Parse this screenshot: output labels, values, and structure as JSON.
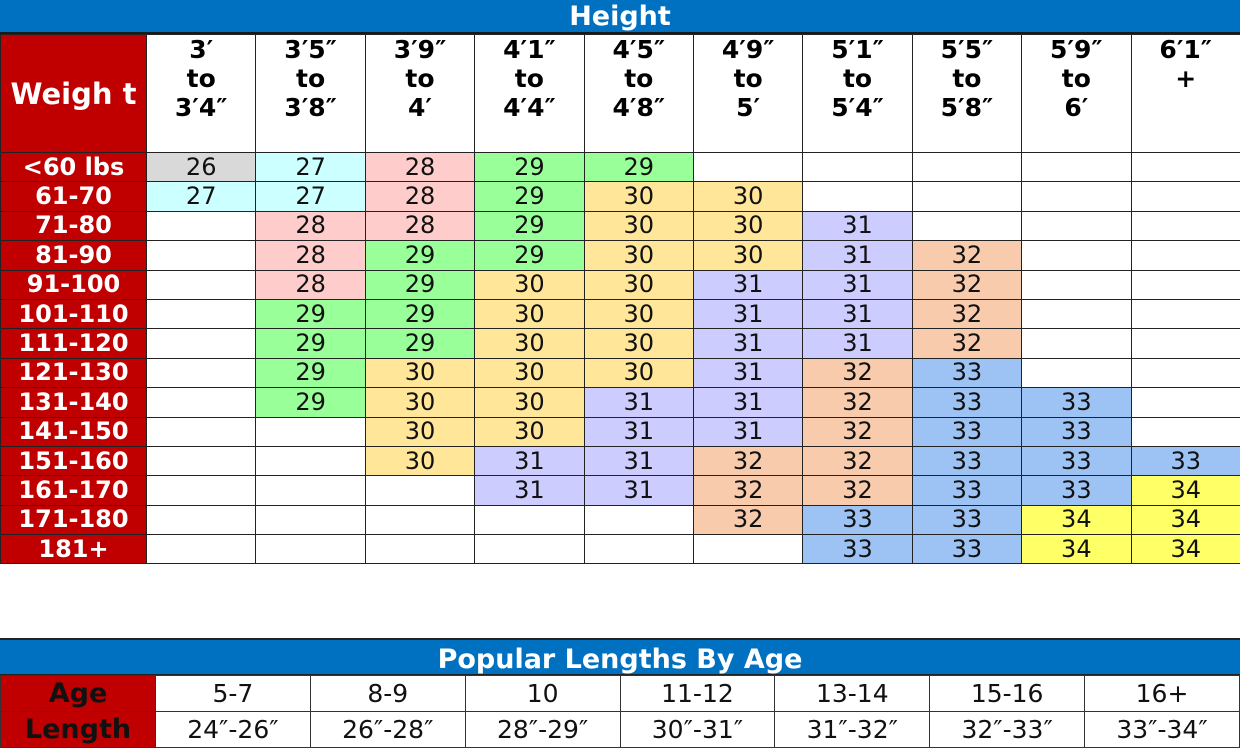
{
  "size_chart": {
    "title": "Height",
    "weight_header": "Weigh t",
    "height_columns": [
      [
        "3′",
        "to",
        "3′4″"
      ],
      [
        "3′5″",
        "to",
        "3′8″"
      ],
      [
        "3′9″",
        "to",
        "4′"
      ],
      [
        "4′1″",
        "to",
        "4′4″"
      ],
      [
        "4′5″",
        "to",
        "4′8″"
      ],
      [
        "4′9″",
        "to",
        "5′"
      ],
      [
        "5′1″",
        "to",
        "5′4″"
      ],
      [
        "5′5″",
        "to",
        "5′8″"
      ],
      [
        "5′9″",
        "to",
        "6′"
      ],
      [
        "6′1″",
        "+",
        ""
      ]
    ],
    "rows": [
      {
        "weight": "<60 lbs",
        "values": [
          "26",
          "27",
          "28",
          "29",
          "29",
          "",
          "",
          "",
          "",
          ""
        ]
      },
      {
        "weight": "61-70",
        "values": [
          "27",
          "27",
          "28",
          "29",
          "30",
          "30",
          "",
          "",
          "",
          ""
        ]
      },
      {
        "weight": "71-80",
        "values": [
          "",
          "28",
          "28",
          "29",
          "30",
          "30",
          "31",
          "",
          "",
          ""
        ]
      },
      {
        "weight": "81-90",
        "values": [
          "",
          "28",
          "29",
          "29",
          "30",
          "30",
          "31",
          "32",
          "",
          ""
        ]
      },
      {
        "weight": "91-100",
        "values": [
          "",
          "28",
          "29",
          "30",
          "30",
          "31",
          "31",
          "32",
          "",
          ""
        ]
      },
      {
        "weight": "101-110",
        "values": [
          "",
          "29",
          "29",
          "30",
          "30",
          "31",
          "31",
          "32",
          "",
          ""
        ]
      },
      {
        "weight": "111-120",
        "values": [
          "",
          "29",
          "29",
          "30",
          "30",
          "31",
          "31",
          "32",
          "",
          ""
        ]
      },
      {
        "weight": "121-130",
        "values": [
          "",
          "29",
          "30",
          "30",
          "30",
          "31",
          "32",
          "33",
          "",
          ""
        ]
      },
      {
        "weight": "131-140",
        "values": [
          "",
          "29",
          "30",
          "30",
          "31",
          "31",
          "32",
          "33",
          "33",
          ""
        ]
      },
      {
        "weight": "141-150",
        "values": [
          "",
          "",
          "30",
          "30",
          "31",
          "31",
          "32",
          "33",
          "33",
          ""
        ]
      },
      {
        "weight": "151-160",
        "values": [
          "",
          "",
          "30",
          "31",
          "31",
          "32",
          "32",
          "33",
          "33",
          "33"
        ]
      },
      {
        "weight": "161-170",
        "values": [
          "",
          "",
          "",
          "31",
          "31",
          "32",
          "32",
          "33",
          "33",
          "34"
        ]
      },
      {
        "weight": "171-180",
        "values": [
          "",
          "",
          "",
          "",
          "",
          "32",
          "33",
          "33",
          "34",
          "34"
        ]
      },
      {
        "weight": "181+",
        "values": [
          "",
          "",
          "",
          "",
          "",
          "",
          "33",
          "33",
          "34",
          "34"
        ]
      }
    ],
    "size_colors": {
      "26": "#d9d9d9",
      "27": "#ccffff",
      "28": "#ffcccc",
      "29": "#99ff99",
      "30": "#ffe699",
      "31": "#ccccff",
      "32": "#f8cbad",
      "33": "#9dc3f5",
      "34": "#ffff66"
    }
  },
  "age_chart": {
    "title": "Popular Lengths By Age",
    "age_label": "Age",
    "length_label": "Length",
    "ages": [
      "5-7",
      "8-9",
      "10",
      "11-12",
      "13-14",
      "15-16",
      "16+"
    ],
    "lengths": [
      "24″-26″",
      "26″-28″",
      "28″-29″",
      "30″-31″",
      "31″-32″",
      "32″-33″",
      "33″-34″"
    ]
  }
}
